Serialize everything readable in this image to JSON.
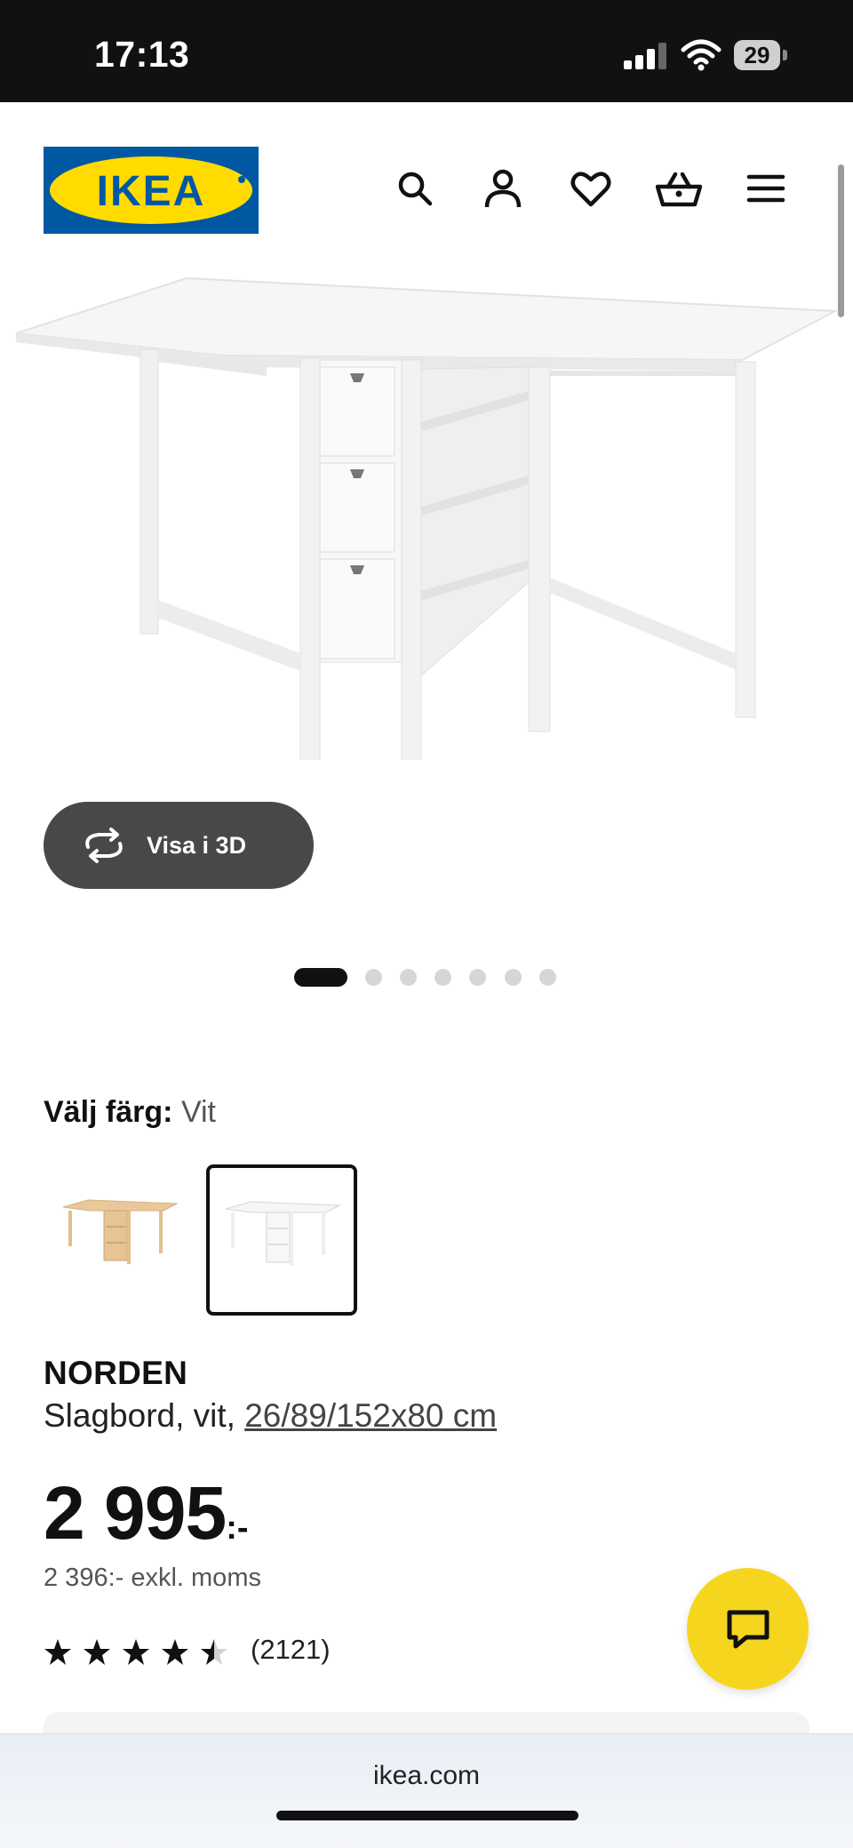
{
  "status": {
    "time": "17:13",
    "battery": "29"
  },
  "header": {
    "logo_text": "IKEA",
    "brand_colors": {
      "blue": "#0058a3",
      "yellow": "#ffdb00"
    },
    "icons": [
      "search-icon",
      "account-icon",
      "heart-icon",
      "basket-icon",
      "menu-icon"
    ]
  },
  "gallery": {
    "view3d_label": "Visa i 3D",
    "slide_count": 7,
    "active_slide": 1
  },
  "color_select": {
    "label": "Välj färg:",
    "value": "Vit",
    "options": [
      "Björk",
      "Vit"
    ],
    "selected_index": 1
  },
  "product": {
    "name": "NORDEN",
    "type": "Slagbord, vit,",
    "dimensions": "26/89/152x80 cm",
    "price": "2 995",
    "price_suffix": ":-",
    "price_excl": "2 396:- exkl. moms",
    "rating_stars": 4.5,
    "rating_max": 5,
    "review_count": "(2121)"
  },
  "browser": {
    "url": "ikea.com"
  },
  "chat": {
    "icon": "chat-icon",
    "color": "#f6d51e"
  }
}
